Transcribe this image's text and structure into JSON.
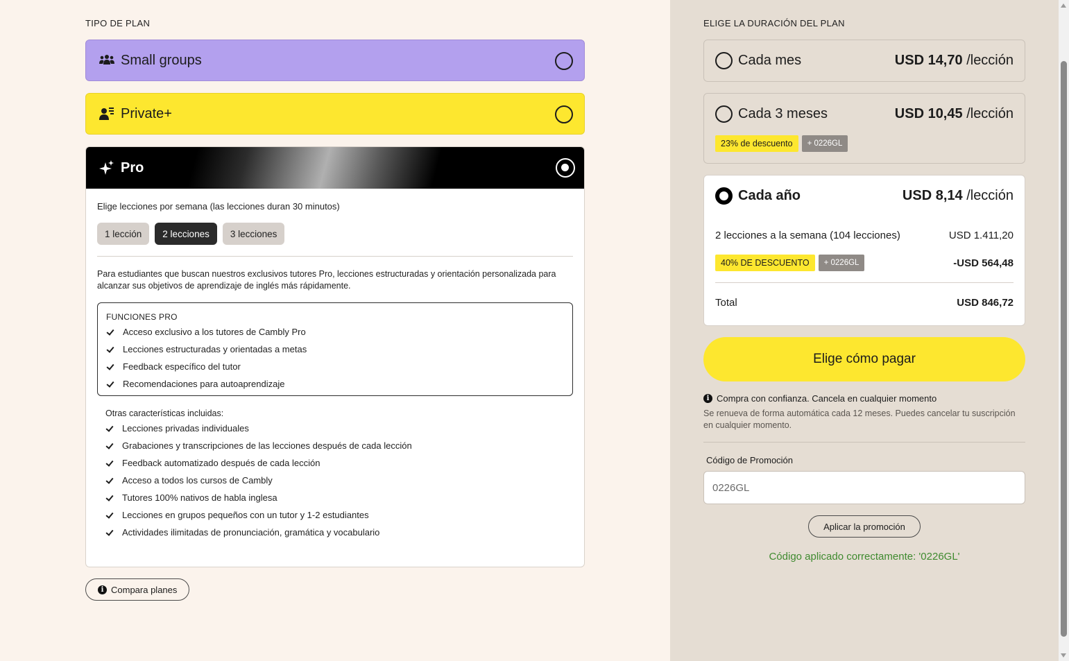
{
  "plan_type": {
    "title": "TIPO DE PLAN",
    "plans": [
      {
        "label": "Small groups",
        "icon": "group-icon",
        "selected": false,
        "color": "#b3a0ee"
      },
      {
        "label": "Private+",
        "icon": "private-tutor-icon",
        "selected": false,
        "color": "#fde72f"
      },
      {
        "label": "Pro",
        "icon": "sparkle-icon",
        "selected": true
      }
    ]
  },
  "pro": {
    "lessons_label": "Elige lecciones por semana (las lecciones duran 30 minutos)",
    "lesson_options": [
      "1 lección",
      "2 lecciones",
      "3 lecciones"
    ],
    "lesson_selected": "2 lecciones",
    "description": "Para estudiantes que buscan nuestros exclusivos tutores Pro, lecciones estructuradas y orientación personalizada para alcanzar sus objetivos de aprendizaje de inglés más rápidamente.",
    "features_title": "FUNCIONES PRO",
    "features": [
      "Acceso exclusivo a los tutores de Cambly Pro",
      "Lecciones estructuradas y orientadas a metas",
      "Feedback específico del tutor",
      "Recomendaciones para autoaprendizaje"
    ],
    "others_title": "Otras características incluidas:",
    "others": [
      "Lecciones privadas individuales",
      "Grabaciones y transcripciones de las lecciones después de cada lección",
      "Feedback automatizado después de cada lección",
      "Acceso a todos los cursos de Cambly",
      "Tutores 100% nativos de habla inglesa",
      "Lecciones en grupos pequeños con un tutor y 1-2 estudiantes",
      "Actividades ilimitadas de pronunciación, gramática y vocabulario"
    ]
  },
  "compare_label": "Compara planes",
  "duration": {
    "title": "ELIGE LA DURACIÓN DEL PLAN",
    "monthly": {
      "label": "Cada mes",
      "price": "USD 14,70",
      "unit": "/lección"
    },
    "quarterly": {
      "label": "Cada 3 meses",
      "price": "USD 10,45",
      "unit": "/lección",
      "discount": "23% de descuento",
      "promo": "+ 0226GL"
    },
    "yearly": {
      "label": "Cada año",
      "price": "USD 8,14",
      "unit": "/lección",
      "selected": true,
      "line_label": "2 lecciones a la semana (104 lecciones)",
      "line_value": "USD 1.411,20",
      "discount": "40% DE DESCUENTO",
      "promo": "+ 0226GL",
      "discount_value": "-USD 564,48",
      "total_label": "Total",
      "total_value": "USD 846,72"
    }
  },
  "pay_button": "Elige cómo pagar",
  "confidence": "Compra con confianza. Cancela en cualquier momento",
  "renew": "Se renueva de forma automática cada 12 meses. Puedes cancelar tu suscripción en cualquier momento.",
  "promo": {
    "label": "Código de Promoción",
    "value": "0226GL",
    "apply": "Aplicar la promoción",
    "success": "Código aplicado correctamente: '0226GL'"
  },
  "colors": {
    "accent_yellow": "#fde72f",
    "success_green": "#3f8a2f",
    "panel": "#e5ddd3",
    "page": "#fbf3ec"
  }
}
